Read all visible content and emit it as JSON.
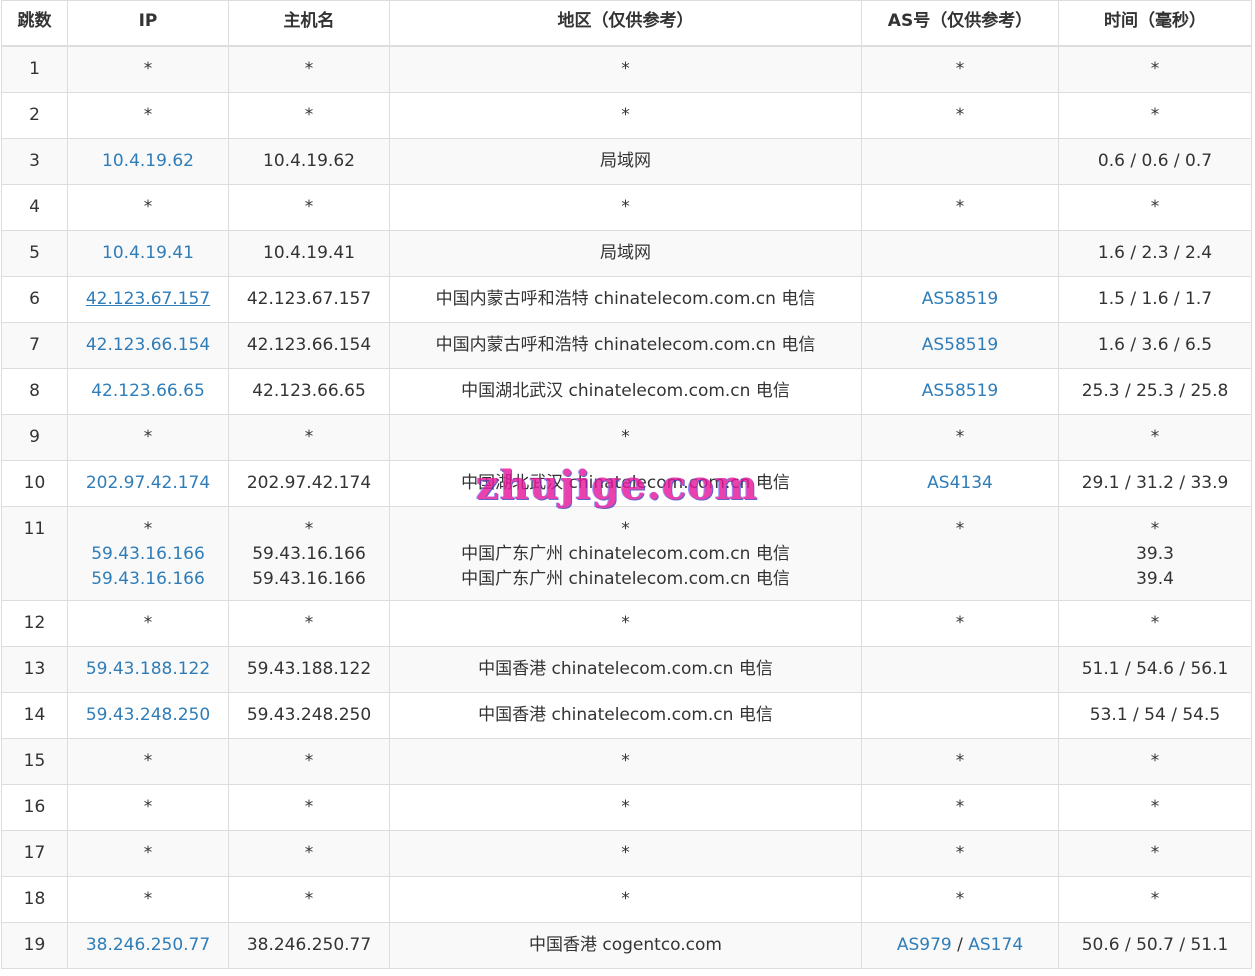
{
  "headers": [
    "跳数",
    "IP",
    "主机名",
    "地区（仅供参考）",
    "AS号（仅供参考）",
    "时间（毫秒）"
  ],
  "rows": [
    {
      "hop": "1",
      "ips": [
        "*"
      ],
      "hosts": [
        "*"
      ],
      "regions": [
        "*"
      ],
      "as": [
        "*"
      ],
      "times": [
        "*"
      ]
    },
    {
      "hop": "2",
      "ips": [
        "*"
      ],
      "hosts": [
        "*"
      ],
      "regions": [
        "*"
      ],
      "as": [
        "*"
      ],
      "times": [
        "*"
      ]
    },
    {
      "hop": "3",
      "ips": [
        "10.4.19.62"
      ],
      "hosts": [
        "10.4.19.62"
      ],
      "regions": [
        "局域网"
      ],
      "as": [],
      "times": [
        "0.6 / 0.6 / 0.7"
      ]
    },
    {
      "hop": "4",
      "ips": [
        "*"
      ],
      "hosts": [
        "*"
      ],
      "regions": [
        "*"
      ],
      "as": [
        "*"
      ],
      "times": [
        "*"
      ]
    },
    {
      "hop": "5",
      "ips": [
        "10.4.19.41"
      ],
      "hosts": [
        "10.4.19.41"
      ],
      "regions": [
        "局域网"
      ],
      "as": [],
      "times": [
        "1.6 / 2.3 / 2.4"
      ]
    },
    {
      "hop": "6",
      "ips": [
        "42.123.67.157"
      ],
      "hosts": [
        "42.123.67.157"
      ],
      "regions": [
        "中国内蒙古呼和浩特 chinatelecom.com.cn 电信"
      ],
      "as": [
        "AS58519"
      ],
      "times": [
        "1.5 / 1.6 / 1.7"
      ]
    },
    {
      "hop": "7",
      "ips": [
        "42.123.66.154"
      ],
      "hosts": [
        "42.123.66.154"
      ],
      "regions": [
        "中国内蒙古呼和浩特 chinatelecom.com.cn 电信"
      ],
      "as": [
        "AS58519"
      ],
      "times": [
        "1.6 / 3.6 / 6.5"
      ]
    },
    {
      "hop": "8",
      "ips": [
        "42.123.66.65"
      ],
      "hosts": [
        "42.123.66.65"
      ],
      "regions": [
        "中国湖北武汉 chinatelecom.com.cn 电信"
      ],
      "as": [
        "AS58519"
      ],
      "times": [
        "25.3 / 25.3 / 25.8"
      ]
    },
    {
      "hop": "9",
      "ips": [
        "*"
      ],
      "hosts": [
        "*"
      ],
      "regions": [
        "*"
      ],
      "as": [
        "*"
      ],
      "times": [
        "*"
      ]
    },
    {
      "hop": "10",
      "ips": [
        "202.97.42.174"
      ],
      "hosts": [
        "202.97.42.174"
      ],
      "regions": [
        "中国湖北武汉 chinatelecom.com.cn 电信"
      ],
      "as": [
        "AS4134"
      ],
      "times": [
        "29.1 / 31.2 / 33.9"
      ]
    },
    {
      "hop": "11",
      "ips": [
        "*",
        "59.43.16.166",
        "59.43.16.166"
      ],
      "hosts": [
        "*",
        "59.43.16.166",
        "59.43.16.166"
      ],
      "regions": [
        "*",
        "中国广东广州 chinatelecom.com.cn 电信",
        "中国广东广州 chinatelecom.com.cn 电信"
      ],
      "as": [
        "*"
      ],
      "times": [
        "*",
        "39.3",
        "39.4"
      ]
    },
    {
      "hop": "12",
      "ips": [
        "*"
      ],
      "hosts": [
        "*"
      ],
      "regions": [
        "*"
      ],
      "as": [
        "*"
      ],
      "times": [
        "*"
      ]
    },
    {
      "hop": "13",
      "ips": [
        "59.43.188.122"
      ],
      "hosts": [
        "59.43.188.122"
      ],
      "regions": [
        "中国香港 chinatelecom.com.cn 电信"
      ],
      "as": [],
      "times": [
        "51.1 / 54.6 / 56.1"
      ]
    },
    {
      "hop": "14",
      "ips": [
        "59.43.248.250"
      ],
      "hosts": [
        "59.43.248.250"
      ],
      "regions": [
        "中国香港 chinatelecom.com.cn 电信"
      ],
      "as": [],
      "times": [
        "53.1 / 54 / 54.5"
      ]
    },
    {
      "hop": "15",
      "ips": [
        "*"
      ],
      "hosts": [
        "*"
      ],
      "regions": [
        "*"
      ],
      "as": [
        "*"
      ],
      "times": [
        "*"
      ]
    },
    {
      "hop": "16",
      "ips": [
        "*"
      ],
      "hosts": [
        "*"
      ],
      "regions": [
        "*"
      ],
      "as": [
        "*"
      ],
      "times": [
        "*"
      ]
    },
    {
      "hop": "17",
      "ips": [
        "*"
      ],
      "hosts": [
        "*"
      ],
      "regions": [
        "*"
      ],
      "as": [
        "*"
      ],
      "times": [
        "*"
      ]
    },
    {
      "hop": "18",
      "ips": [
        "*"
      ],
      "hosts": [
        "*"
      ],
      "regions": [
        "*"
      ],
      "as": [
        "*"
      ],
      "times": [
        "*"
      ]
    },
    {
      "hop": "19",
      "ips": [
        "38.246.250.77"
      ],
      "hosts": [
        "38.246.250.77"
      ],
      "regions": [
        "中国香港 cogentco.com"
      ],
      "as": [
        "AS979",
        "AS174"
      ],
      "times": [
        "50.6 / 50.7 / 51.1"
      ]
    }
  ],
  "underlined_ip": "42.123.67.157",
  "as_separator": " / ",
  "watermark": "zhujige.com",
  "colors": {
    "link": "#2f7db8",
    "text": "#333333",
    "border": "#dddddd",
    "stripe": "#f9f9f9",
    "watermark": "#e6189a"
  }
}
